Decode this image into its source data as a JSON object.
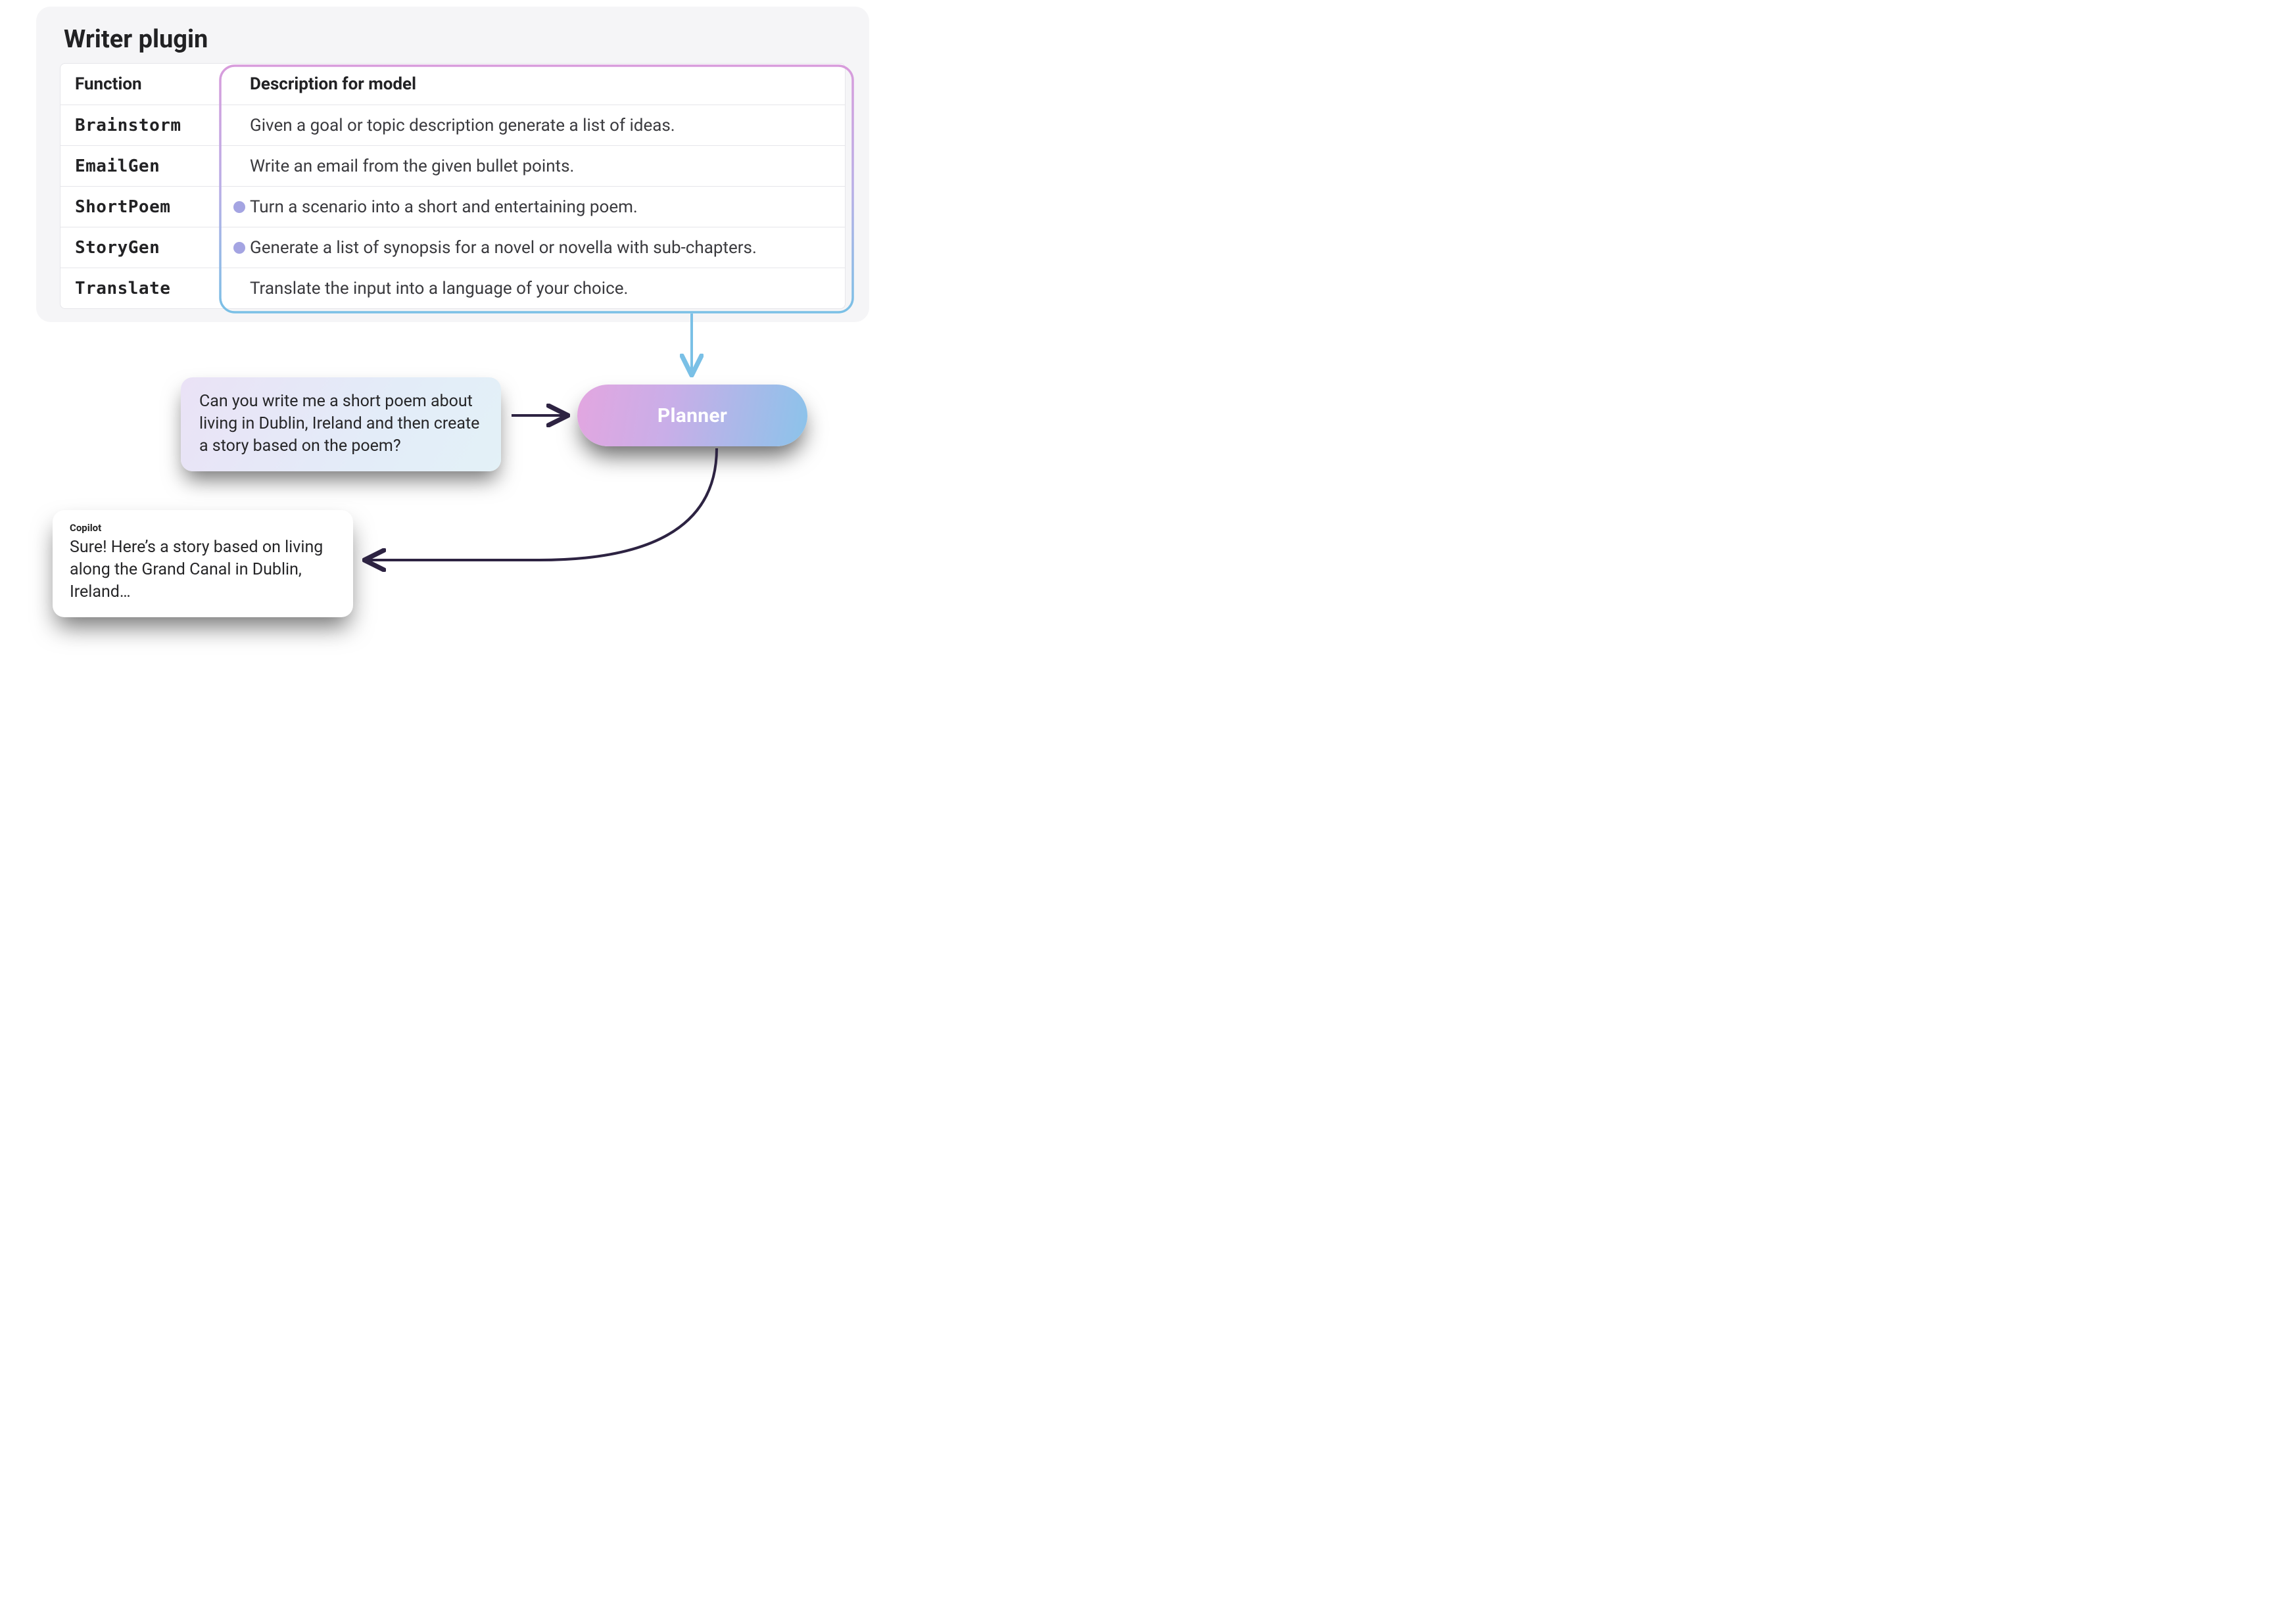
{
  "plugin": {
    "title": "Writer plugin",
    "columns": {
      "fn": "Function",
      "desc": "Description for model"
    },
    "rows": [
      {
        "fn": "Brainstorm",
        "desc": "Given a goal or topic description generate a list of ideas.",
        "selected": false
      },
      {
        "fn": "EmailGen",
        "desc": "Write an email from the given bullet points.",
        "selected": false
      },
      {
        "fn": "ShortPoem",
        "desc": "Turn a scenario into a short and entertaining poem.",
        "selected": true
      },
      {
        "fn": "StoryGen",
        "desc": "Generate a list of synopsis for a novel or novella with sub-chapters.",
        "selected": true
      },
      {
        "fn": "Translate",
        "desc": "Translate the input into a language of your choice.",
        "selected": false
      }
    ]
  },
  "prompt": {
    "text": "Can you write me a short poem about living in Dublin, Ireland and then create a story based on the poem?"
  },
  "planner": {
    "label": "Planner"
  },
  "response": {
    "sender": "Copilot",
    "text": "Sure! Here’s a story based on living along the Grand Canal in Dublin, Ireland…"
  },
  "flow": {
    "edges": [
      "plugin-descriptions → planner",
      "user-prompt → planner",
      "planner → copilot-response"
    ]
  }
}
